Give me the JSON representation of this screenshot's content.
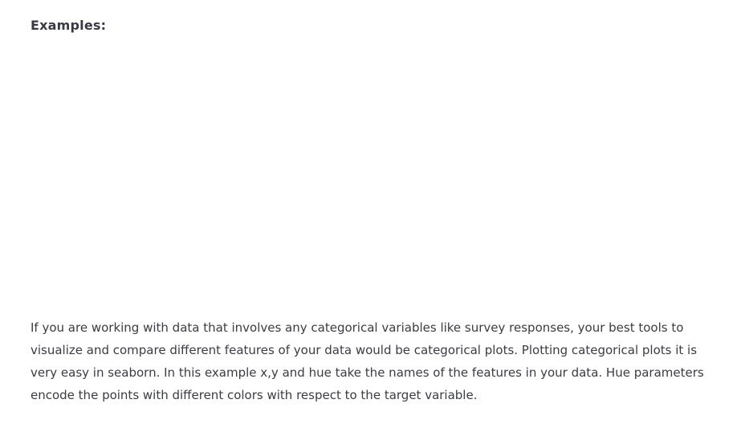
{
  "section": {
    "heading": "Examples:"
  },
  "body": {
    "paragraph": "If you are working with data that involves any categorical variables like survey responses, your best tools to visualize and compare different features of your data would be categorical plots. Plotting categorical plots it is very easy in seaborn. In this example x,y and hue take the names of the features in your data. Hue parameters encode the points with different colors with respect to the target variable."
  }
}
